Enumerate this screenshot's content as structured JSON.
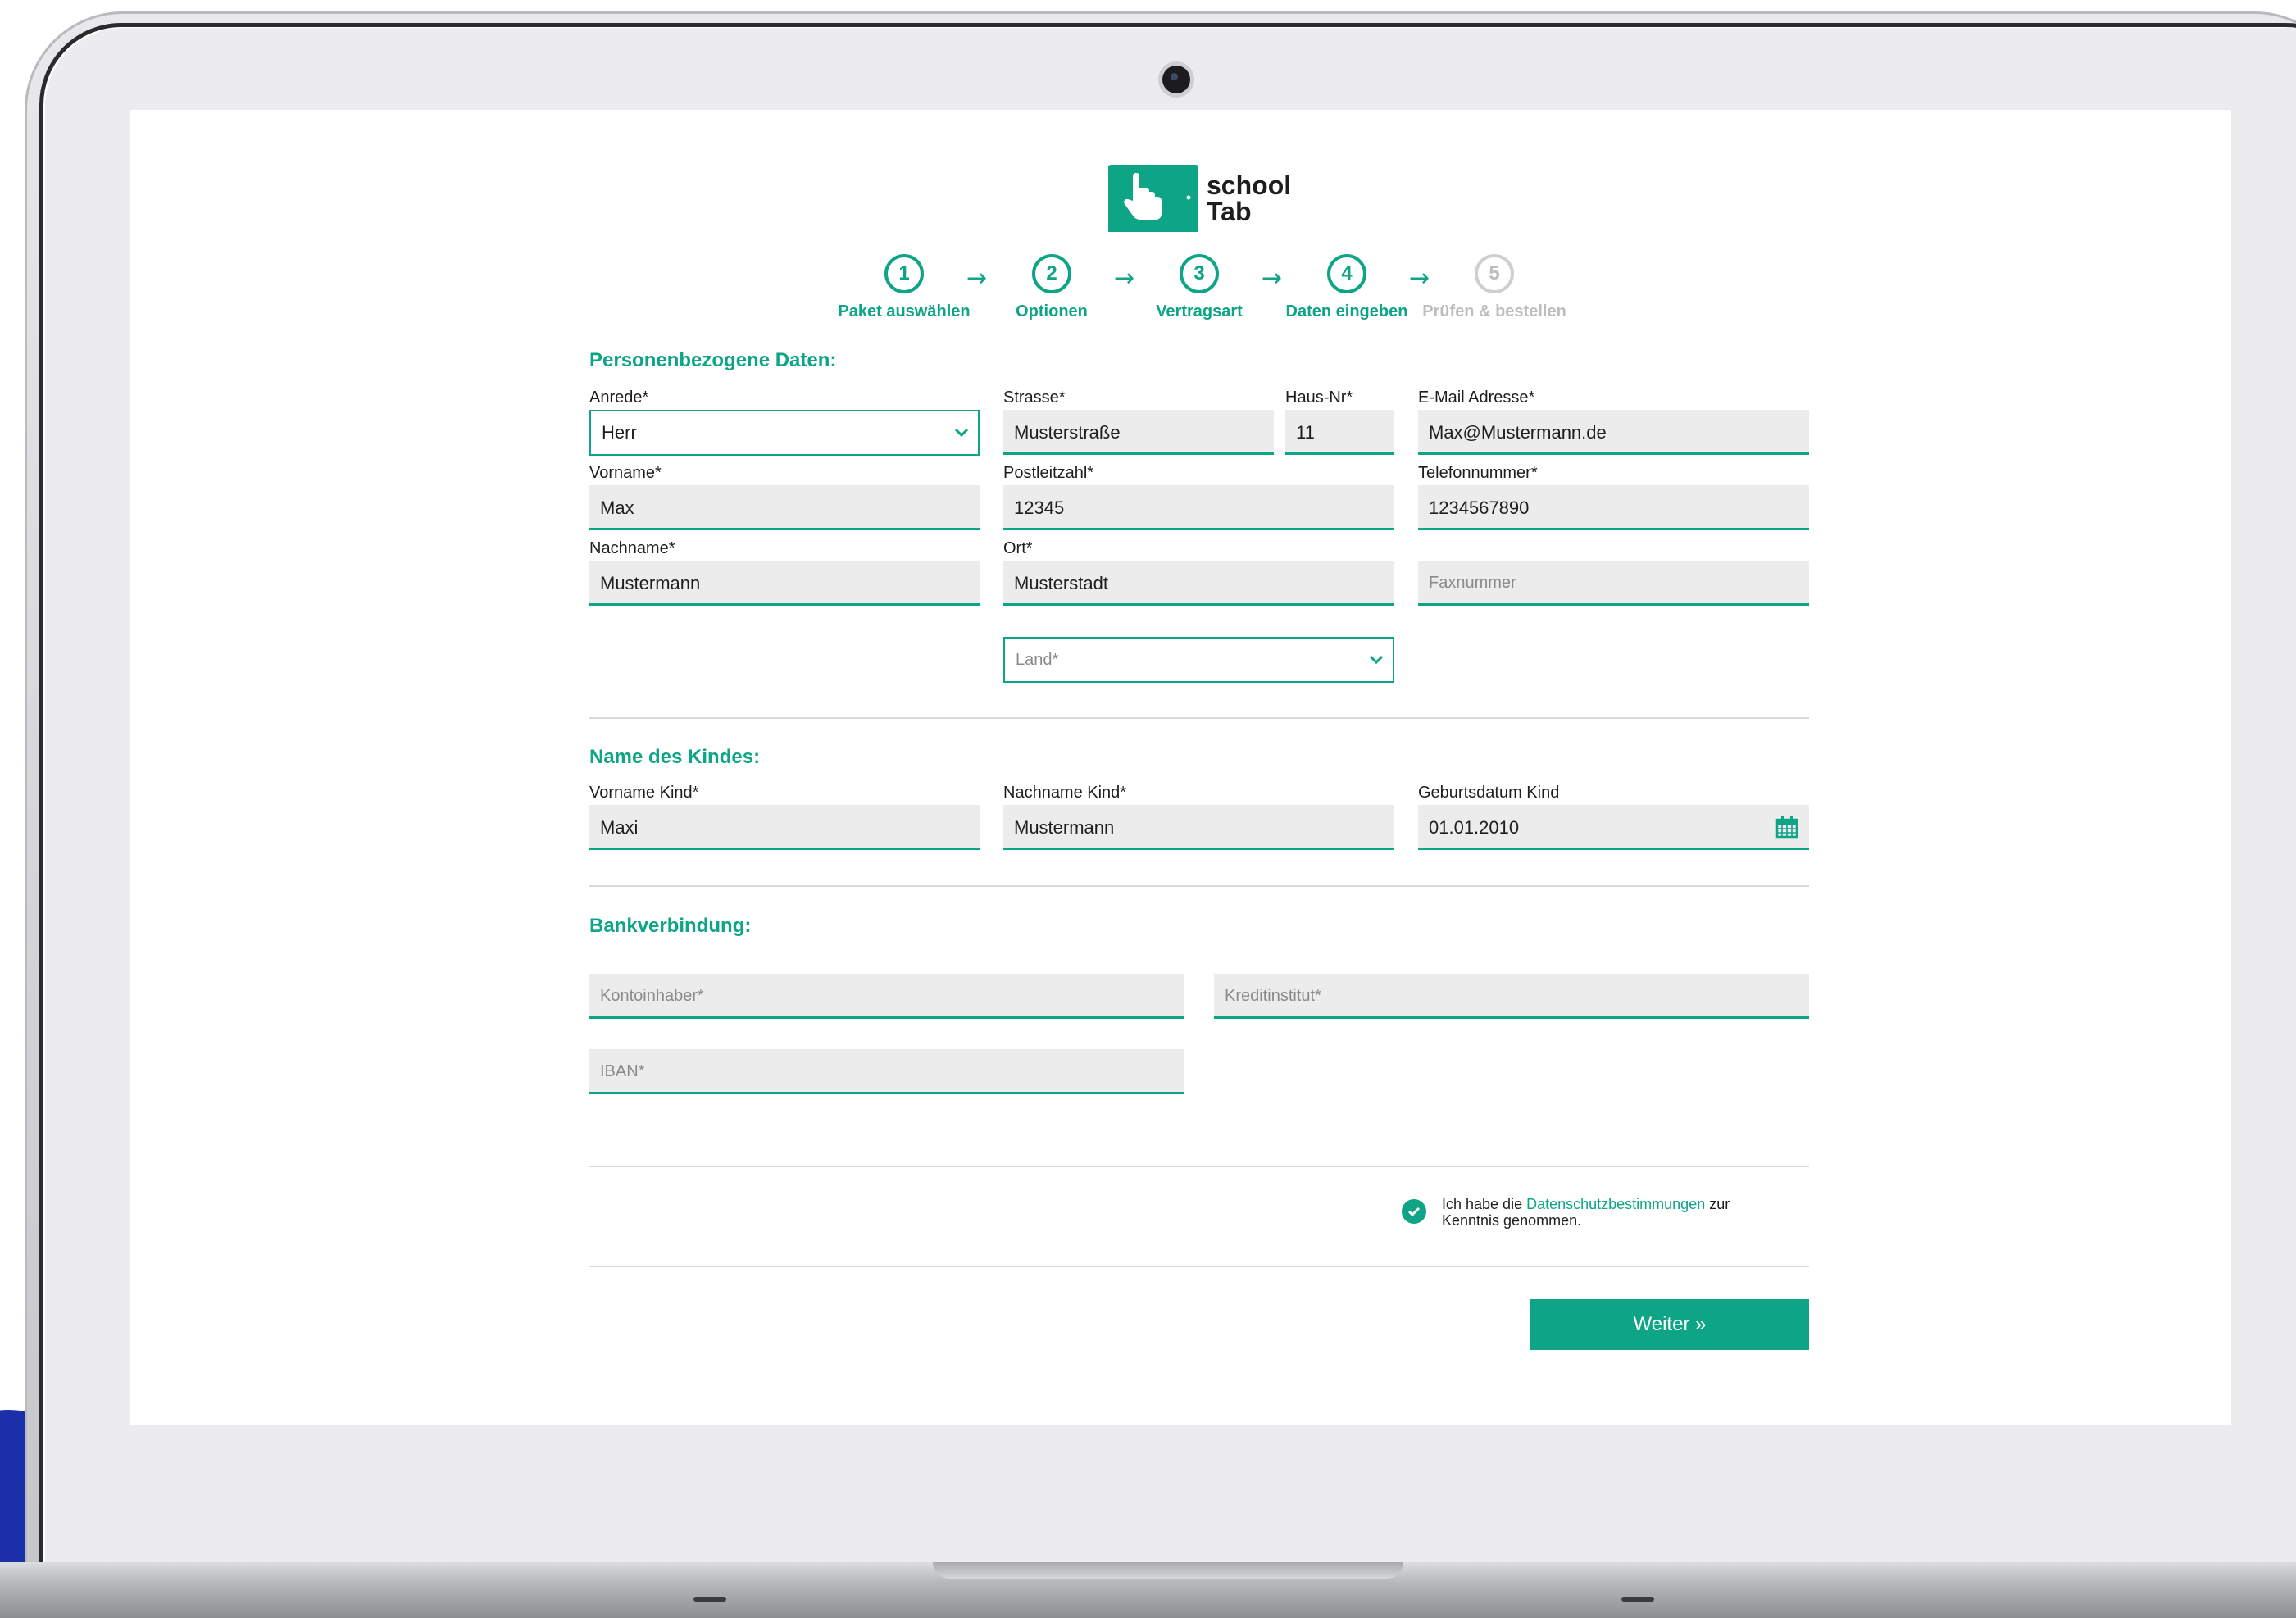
{
  "brand": {
    "line1": "school",
    "line2": "Tab",
    "color": "#0ea486"
  },
  "steps": [
    {
      "num": "1",
      "label": "Paket auswählen",
      "state": "done"
    },
    {
      "num": "2",
      "label": "Optionen",
      "state": "done"
    },
    {
      "num": "3",
      "label": "Vertragsart",
      "state": "done"
    },
    {
      "num": "4",
      "label": "Daten eingeben",
      "state": "current"
    },
    {
      "num": "5",
      "label": "Prüfen & bestellen",
      "state": "disabled"
    }
  ],
  "arrow": "→",
  "personal": {
    "title": "Personenbezogene Daten:",
    "anrede_label": "Anrede*",
    "anrede_value": "Herr",
    "strasse_label": "Strasse*",
    "strasse_value": "Musterstraße",
    "hausnr_label": "Haus-Nr*",
    "hausnr_value": "11",
    "email_label": "E-Mail Adresse*",
    "email_value": "Max@Mustermann.de",
    "vorname_label": "Vorname*",
    "vorname_value": "Max",
    "plz_label": "Postleitzahl*",
    "plz_value": "12345",
    "telefon_label": "Telefonnummer*",
    "telefon_value": "1234567890",
    "nachname_label": "Nachname*",
    "nachname_value": "Mustermann",
    "ort_label": "Ort*",
    "ort_value": "Musterstadt",
    "fax_placeholder": "Faxnummer",
    "land_placeholder": "Land*"
  },
  "child": {
    "title": "Name des Kindes:",
    "vorname_label": "Vorname Kind*",
    "vorname_value": "Maxi",
    "nachname_label": "Nachname Kind*",
    "nachname_value": "Mustermann",
    "geburt_label": "Geburtsdatum Kind",
    "geburt_value": "01.01.2010"
  },
  "bank": {
    "title": "Bankverbindung:",
    "inhaber_placeholder": "Kontoinhaber*",
    "institut_placeholder": "Kreditinstitut*",
    "iban_placeholder": "IBAN*"
  },
  "consent": {
    "before": "Ich habe die",
    "link": "Datenschutzbestimmungen",
    "after": "zur Kenntnis genommen.",
    "checked": true
  },
  "submit": {
    "label": "Weiter »"
  },
  "icons": {
    "select": "chevron-down-icon",
    "date": "calendar-icon",
    "check": "check-icon"
  }
}
